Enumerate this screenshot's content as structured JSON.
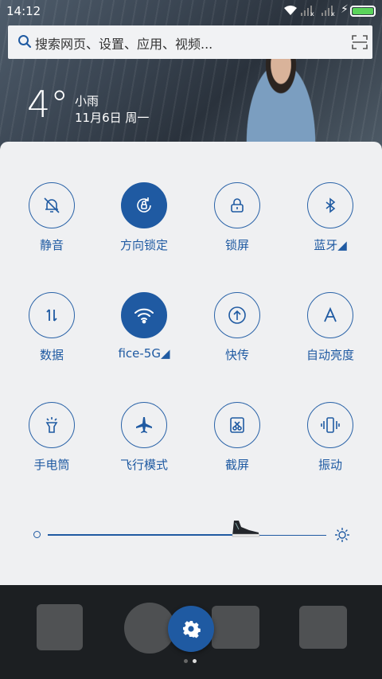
{
  "status_bar": {
    "time": "14:12",
    "signal_1_label": "x",
    "signal_2_label": "x",
    "battery_level": 1.0
  },
  "search": {
    "placeholder": "搜索网页、设置、应用、视频..."
  },
  "weather": {
    "temperature": "4°",
    "condition": "小雨",
    "date": "11月6日 周一"
  },
  "quick_settings": {
    "tiles": [
      {
        "label": "静音",
        "icon": "bell-off-icon",
        "active": false
      },
      {
        "label": "方向锁定",
        "icon": "rotation-lock-icon",
        "active": true
      },
      {
        "label": "锁屏",
        "icon": "lock-icon",
        "active": false
      },
      {
        "label": "蓝牙◢",
        "icon": "bluetooth-icon",
        "active": false
      },
      {
        "label": "数据",
        "icon": "data-arrows-icon",
        "active": false
      },
      {
        "label": "fice-5G◢",
        "icon": "wifi-icon",
        "active": true
      },
      {
        "label": "快传",
        "icon": "upload-icon",
        "active": false
      },
      {
        "label": "自动亮度",
        "icon": "auto-brightness-icon",
        "active": false
      },
      {
        "label": "手电筒",
        "icon": "flashlight-icon",
        "active": false
      },
      {
        "label": "飞行模式",
        "icon": "airplane-icon",
        "active": false
      },
      {
        "label": "截屏",
        "icon": "screenshot-icon",
        "active": false
      },
      {
        "label": "振动",
        "icon": "vibrate-icon",
        "active": false
      }
    ],
    "brightness_level": 0.7
  },
  "colors": {
    "accent": "#1f5aa2",
    "panel": "#eff0f2"
  },
  "pager": {
    "count": 2,
    "current": 1
  }
}
